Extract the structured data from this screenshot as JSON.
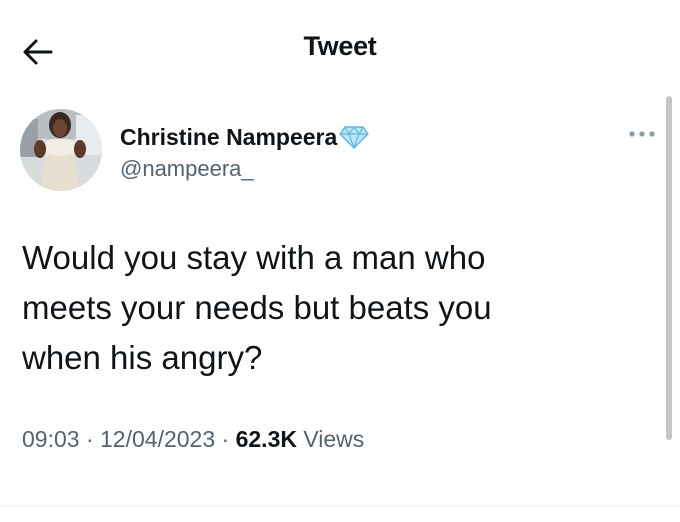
{
  "header": {
    "title": "Tweet",
    "back_icon": "arrow-left-icon"
  },
  "tweet": {
    "author": {
      "display_name": "Christine Nampeera",
      "handle": "@nampeera_",
      "badge_icon": "diamond-icon",
      "avatar": "avatar-photo"
    },
    "more_icon": "more-horizontal-icon",
    "text": "Would you stay with a man who\nmeets your needs but beats you\nwhen his angry?",
    "time": "09:03",
    "separator": "·",
    "date": "12/04/2023",
    "views_count": "62.3K",
    "views_label": "Views"
  },
  "colors": {
    "text_primary": "#0f1419",
    "text_secondary": "#536471",
    "divider": "#eff3f4",
    "badge": "#8fd3f0"
  }
}
